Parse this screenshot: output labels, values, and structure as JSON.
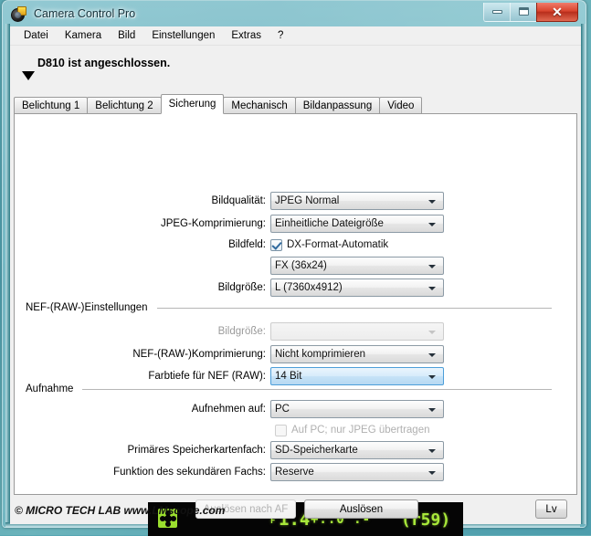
{
  "window": {
    "title": "Camera Control Pro",
    "app_icon": "camera-app-icon",
    "buttons": {
      "minimize": "minimize-icon",
      "maximize": "maximize-icon",
      "close": "✕"
    }
  },
  "menubar": {
    "items": [
      {
        "label": "Datei"
      },
      {
        "label": "Kamera"
      },
      {
        "label": "Bild"
      },
      {
        "label": "Einstellungen"
      },
      {
        "label": "Extras"
      },
      {
        "label": "?"
      }
    ]
  },
  "status": {
    "text": "D810 ist angeschlossen.",
    "caret_icon": "triangle-down-icon"
  },
  "tabs": [
    {
      "label": "Belichtung 1",
      "active": false
    },
    {
      "label": "Belichtung 2",
      "active": false
    },
    {
      "label": "Sicherung",
      "active": true
    },
    {
      "label": "Mechanisch",
      "active": false
    },
    {
      "label": "Bildanpassung",
      "active": false
    },
    {
      "label": "Video",
      "active": false
    }
  ],
  "form": {
    "bildqualitaet": {
      "label": "Bildqualität:",
      "value": "JPEG Normal"
    },
    "jpeg_komprimierung": {
      "label": "JPEG-Komprimierung:",
      "value": "Einheitliche Dateigröße"
    },
    "bildfeld": {
      "label": "Bildfeld:",
      "checkbox_label": "DX-Format-Automatik",
      "checked": true
    },
    "bildfeld_format": {
      "value": "FX (36x24)"
    },
    "bildgroesse": {
      "label": "Bildgröße:",
      "value": "L (7360x4912)"
    },
    "nef_group": {
      "title": "NEF-(RAW-)Einstellungen"
    },
    "nef_bildgroesse": {
      "label": "Bildgröße:",
      "value": "",
      "disabled": true
    },
    "nef_komprimierung": {
      "label": "NEF-(RAW-)Komprimierung:",
      "value": "Nicht komprimieren"
    },
    "nef_farbtiefe": {
      "label": "Farbtiefe für NEF (RAW):",
      "value": "14 Bit",
      "focused": true
    },
    "aufnahme_group": {
      "title": "Aufnahme"
    },
    "aufnehmen_auf": {
      "label": "Aufnehmen auf:",
      "value": "PC"
    },
    "nur_jpeg": {
      "checkbox_label": "Auf PC; nur JPEG übertragen",
      "checked": false,
      "disabled": true
    },
    "primaeres_fach": {
      "label": "Primäres Speicherkartenfach:",
      "value": "SD-Speicherkarte"
    },
    "sekundaeres_fach": {
      "label": "Funktion des sekundären Fachs:",
      "value": "Reserve"
    }
  },
  "lcd": {
    "af_icon": "af-area-icon",
    "f_letter": "F",
    "aperture": "1.4",
    "exposure_scale": "+..0^.-",
    "counter": "(r59)",
    "color": "#a8e83a",
    "background": "#050505"
  },
  "bottom": {
    "release_after_af": "Auslösen nach AF",
    "release": "Auslösen",
    "live_view": "Lv"
  },
  "watermark": "© MICRO TECH LAB  www.LMscope.com"
}
